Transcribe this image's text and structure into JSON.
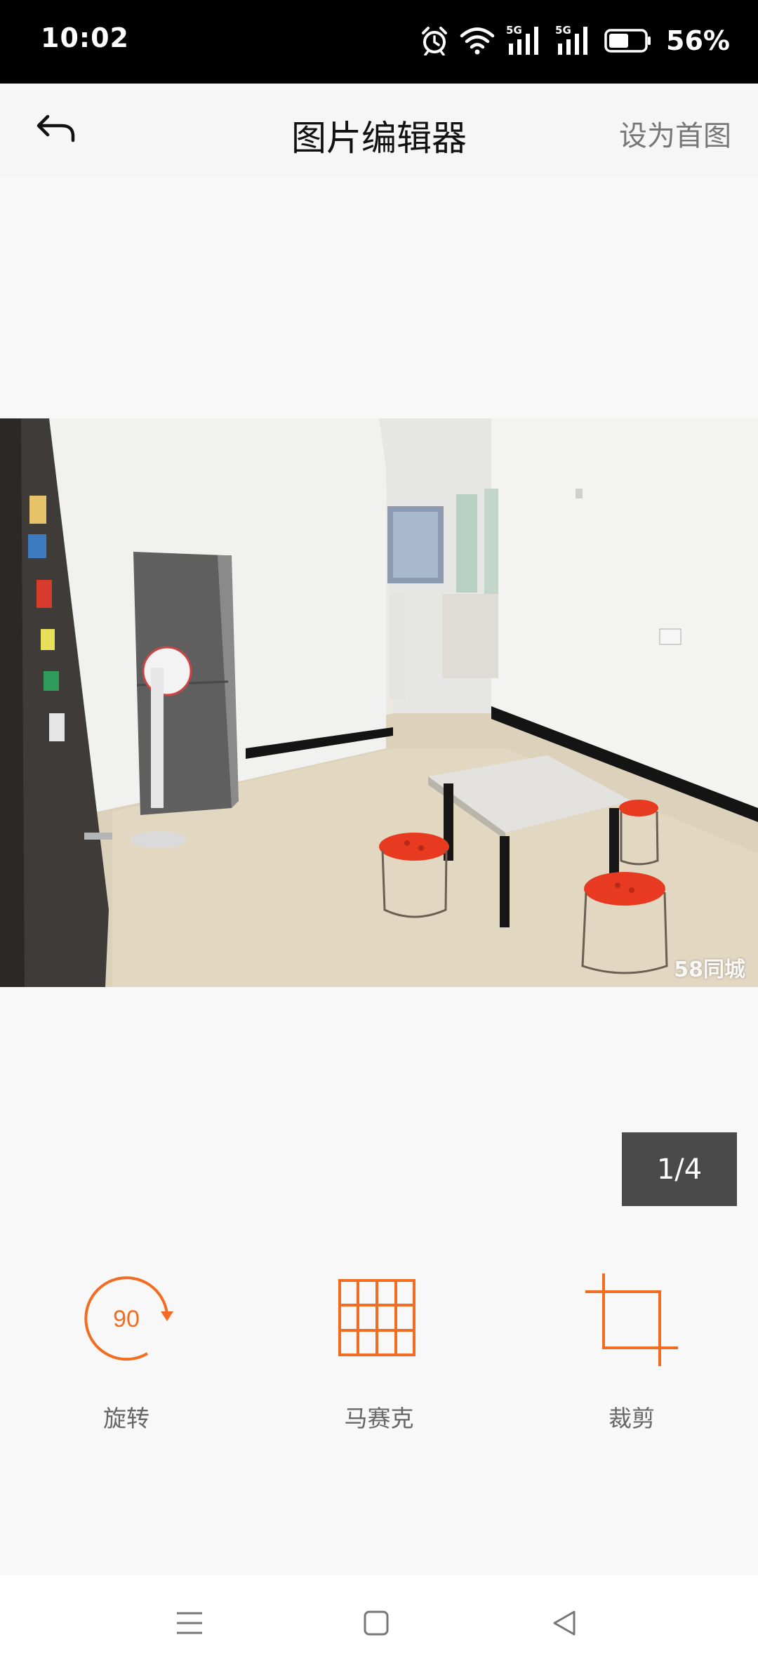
{
  "status_bar": {
    "time": "10:02",
    "network_label_1": "5G",
    "network_label_2": "5G",
    "battery_percent": "56%",
    "battery_level": 0.56,
    "icons": [
      "alarm-icon",
      "wifi-icon",
      "signal-5g-icon",
      "signal-5g-icon",
      "battery-icon"
    ]
  },
  "nav_bar": {
    "back_icon": "back-arrow-icon",
    "title": "图片编辑器",
    "set_cover_label": "设为首图"
  },
  "photo": {
    "description_icon": "room-photo",
    "watermark": "58同城"
  },
  "pager": {
    "current": 1,
    "total": 4,
    "label": "1/4"
  },
  "tools": [
    {
      "icon": "rotate-90-icon",
      "icon_text": "90",
      "label": "旋转"
    },
    {
      "icon": "mosaic-grid-icon",
      "label": "马赛克"
    },
    {
      "icon": "crop-icon",
      "label": "裁剪"
    }
  ],
  "system_nav": {
    "icons": [
      "menu-icon",
      "home-icon",
      "back-triangle-icon"
    ]
  },
  "colors": {
    "accent": "#f26d21",
    "status_bar_bg": "#000000",
    "page_bg": "#f8f8f8",
    "counter_bg": "#4a4a4a"
  }
}
